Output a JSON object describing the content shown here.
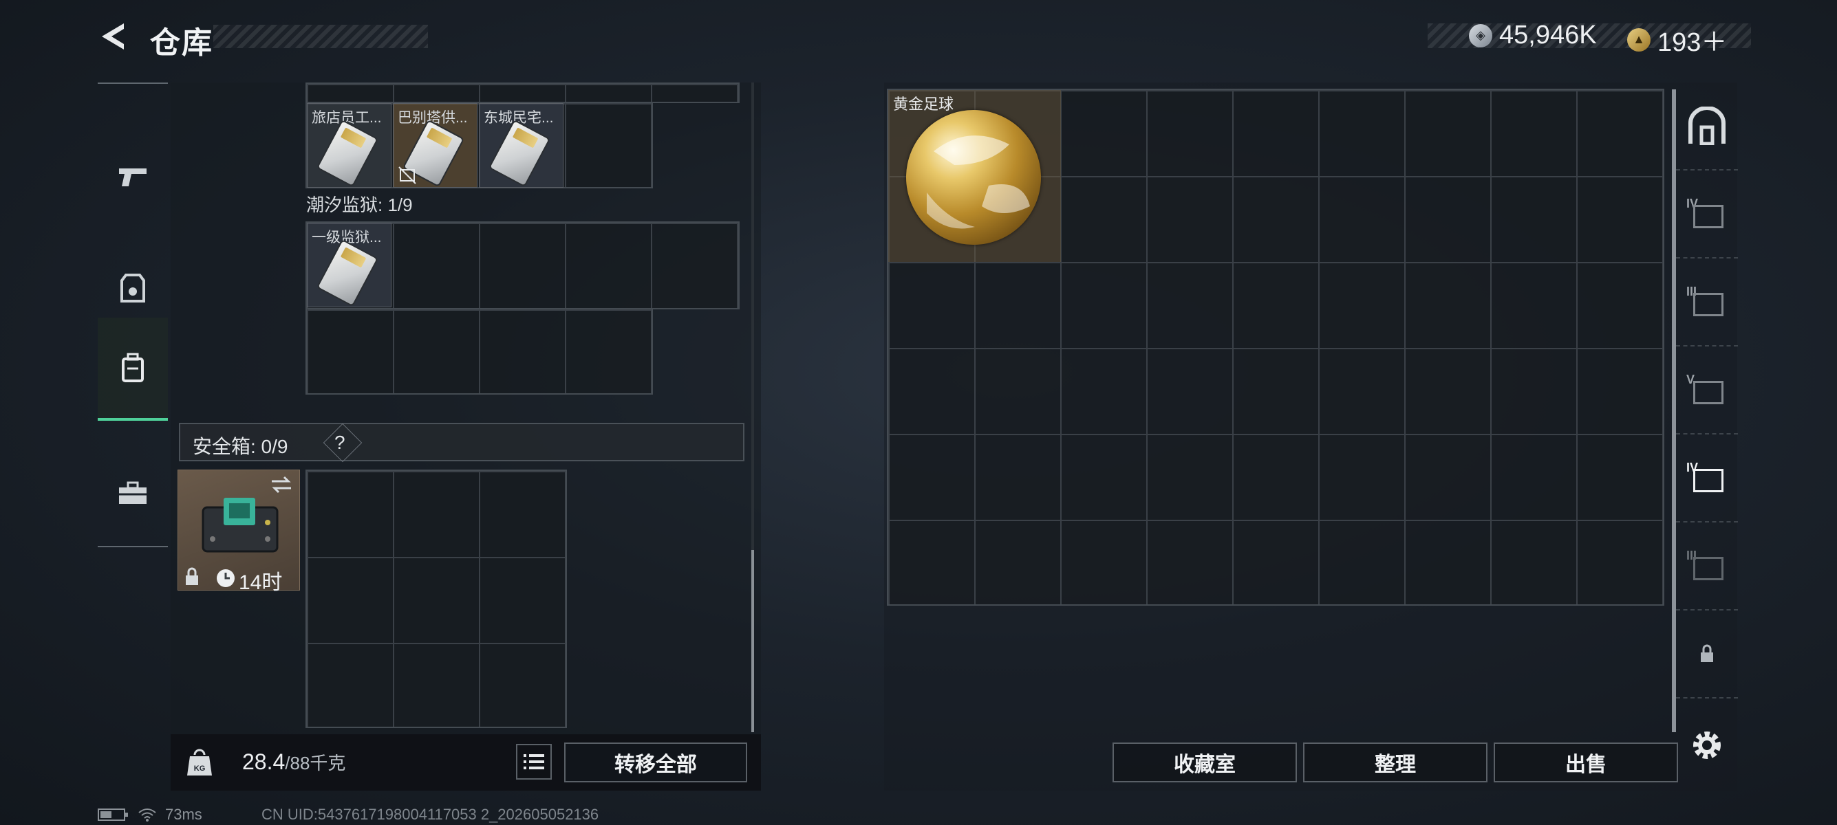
{
  "header": {
    "title": "仓库"
  },
  "currency": [
    {
      "icon": "silver-coin-icon",
      "value": "45,946K"
    },
    {
      "icon": "gold-coin-icon",
      "value": "193＋"
    }
  ],
  "categories": [
    {
      "icon": "pistol-icon"
    },
    {
      "icon": "armor-icon"
    },
    {
      "icon": "backpack-icon",
      "active": true
    },
    {
      "icon": "toolbox-icon"
    }
  ],
  "left": {
    "top_items": [
      {
        "label": "旅店员工..."
      },
      {
        "label": "巴别塔供..."
      },
      {
        "label": "东城民宅..."
      }
    ],
    "prison_section": {
      "label": "潮汐监狱: 1/9"
    },
    "prison_items": [
      {
        "label": "一级监狱..."
      }
    ],
    "safe": {
      "label": "安全箱: 0/9",
      "help": "?",
      "timer": "14时"
    },
    "weight": {
      "current": "28.4",
      "max": "/88千克"
    },
    "transfer_all": "转移全部"
  },
  "right": {
    "item": {
      "label": "黄金足球"
    },
    "buttons": {
      "collection": "收藏室",
      "sort": "整理",
      "sell": "出售"
    }
  },
  "right_tabs": [
    {
      "icon": "vault-icon",
      "tier": ""
    },
    {
      "icon": "storage-tab-icon",
      "tier": "IV"
    },
    {
      "icon": "storage-tab-icon",
      "tier": "III"
    },
    {
      "icon": "storage-tab-icon",
      "tier": "V"
    },
    {
      "icon": "storage-tab-icon",
      "tier": "IV"
    },
    {
      "icon": "storage-tab-icon",
      "tier": "III"
    },
    {
      "icon": "lock-icon",
      "tier": ""
    }
  ],
  "footer": {
    "ping": "73ms",
    "uid": "CN UID:5437617198004117053 2_202605052136"
  },
  "colors": {
    "accent": "#4fd19a",
    "gold": "#c9a64a"
  }
}
